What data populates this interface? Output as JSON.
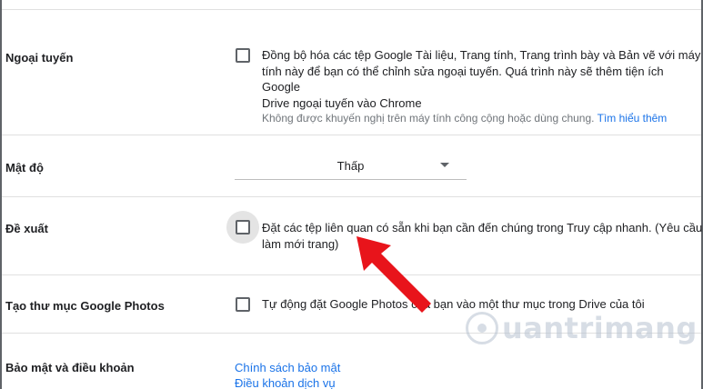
{
  "settings": {
    "offline": {
      "label": "Ngoại tuyến",
      "line1": "Đồng bộ hóa các tệp Google Tài liệu, Trang tính, Trang trình bày và Bản vẽ với máy",
      "line2": "tính này để bạn có thể chỉnh sửa ngoại tuyến. Quá trình này sẽ thêm tiện ích Google",
      "line3": "Drive ngoại tuyến vào Chrome",
      "note": "Không được khuyến nghị trên máy tính công cộng hoặc dùng chung.",
      "learn_more": "Tìm hiểu thêm",
      "checked": false
    },
    "density": {
      "label": "Mật độ",
      "selected": "Thấp"
    },
    "suggestions": {
      "label": "Đề xuất",
      "line1": "Đặt các tệp liên quan có sẵn khi bạn cần đến chúng trong Truy cập nhanh. (Yêu cầu",
      "line2": "làm mới trang)",
      "checked": false
    },
    "photos_folder": {
      "label": "Tạo thư mục Google Photos",
      "text": "Tự động đặt Google Photos của bạn vào một thư mục trong Drive của tôi",
      "checked": false
    },
    "privacy": {
      "label": "Bảo mật và điều khoản",
      "privacy_policy": "Chính sách bảo mật",
      "terms": "Điều khoản dịch vụ"
    }
  },
  "colors": {
    "accent": "#1a73e8",
    "arrow": "#e8141b",
    "divider": "#e0e0e0"
  },
  "watermark": {
    "text": "uantrimang"
  }
}
